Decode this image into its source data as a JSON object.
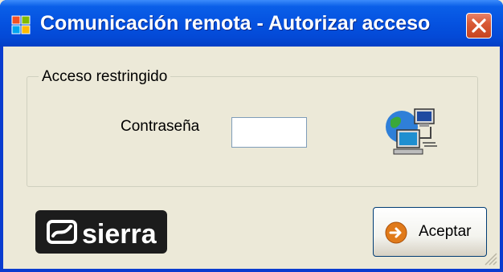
{
  "window": {
    "title": "Comunicación remota - Autorizar acceso",
    "app_icon": "windows-app-icon",
    "close_icon": "close-icon"
  },
  "group": {
    "label": "Acceso restringido"
  },
  "password": {
    "label": "Contraseña",
    "value": ""
  },
  "decor": {
    "network_icon": "network-computers-icon"
  },
  "logo": {
    "text": "sierra",
    "icon": "sierra-logo"
  },
  "buttons": {
    "accept_label": "Aceptar",
    "accept_icon": "arrow-right-circle-icon"
  },
  "colors": {
    "titlebar": "#0552e0",
    "face": "#ece9d8",
    "close": "#d95a36"
  }
}
